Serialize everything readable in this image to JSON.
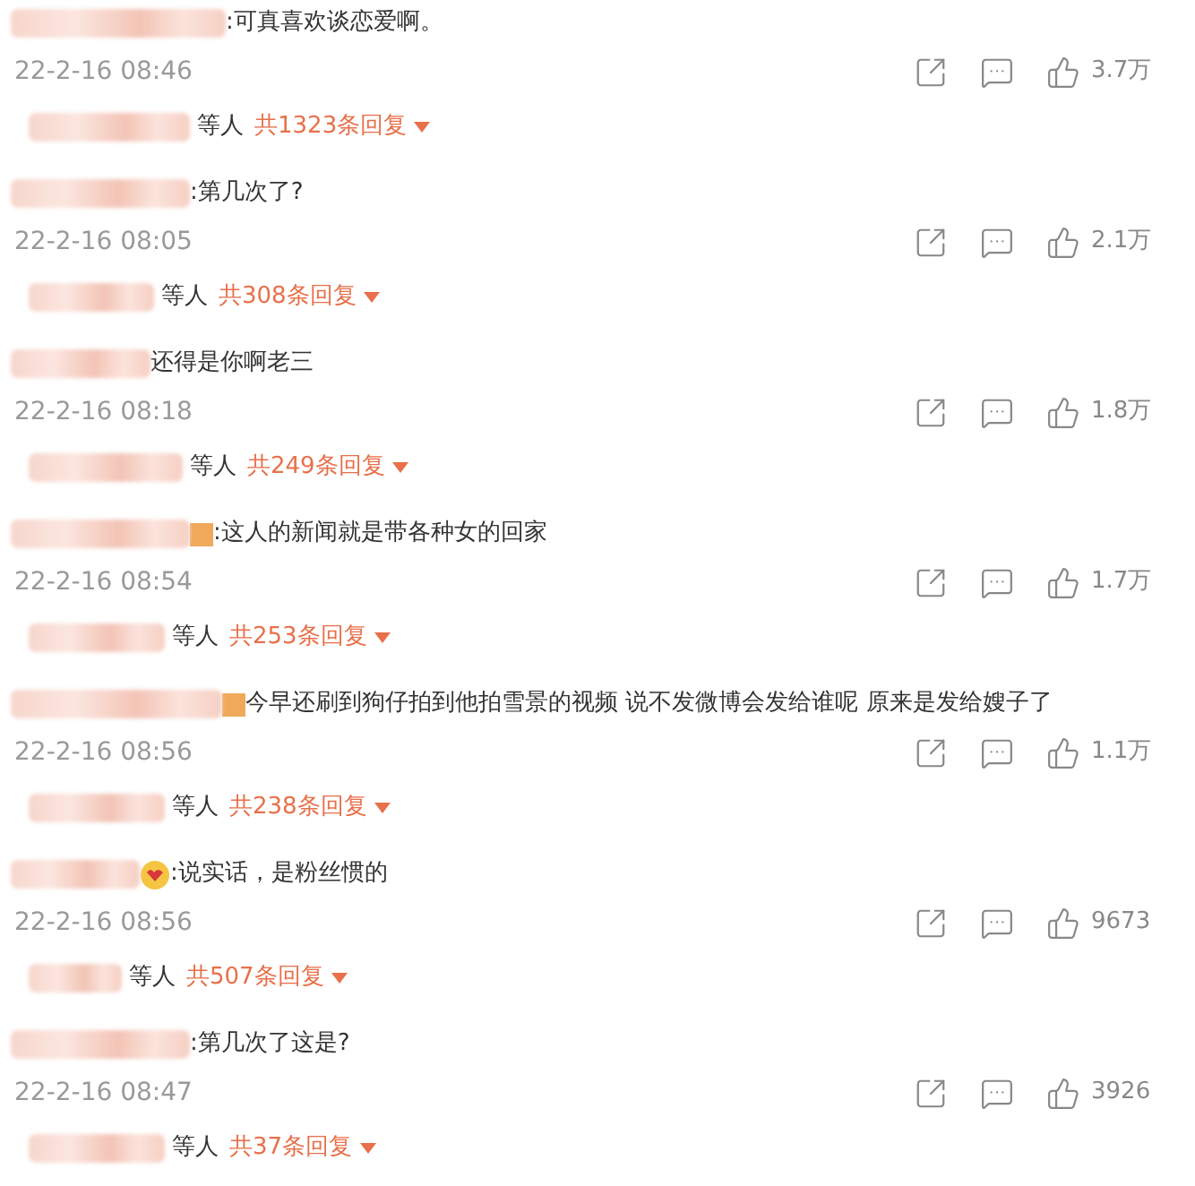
{
  "comments": [
    {
      "kind": "plain",
      "text": ":可真喜欢谈恋爱啊。",
      "time": "22-2-16 08:46",
      "likes": "3.7万",
      "reply_suffix": "等人",
      "reply_count": "共1323条回复"
    },
    {
      "kind": "plain",
      "text": ":第几次了?",
      "time": "22-2-16 08:05",
      "likes": "2.1万",
      "reply_suffix": "等人",
      "reply_count": "共308条回复"
    },
    {
      "kind": "plain",
      "text": "还得是你啊老三",
      "time": "22-2-16 08:18",
      "likes": "1.8万",
      "reply_suffix": "等人",
      "reply_count": "共249条回复"
    },
    {
      "kind": "badge",
      "text": ":这人的新闻就是带各种女的回家",
      "time": "22-2-16 08:54",
      "likes": "1.7万",
      "reply_suffix": "等人",
      "reply_count": "共253条回复"
    },
    {
      "kind": "badge",
      "text": "今早还刷到狗仔拍到他拍雪景的视频 说不发微博会发给谁呢 原来是发给嫂子了",
      "time": "22-2-16 08:56",
      "likes": "1.1万",
      "reply_suffix": "等人",
      "reply_count": "共238条回复"
    },
    {
      "kind": "emoji",
      "text": ":说实话，是粉丝惯的",
      "time": "22-2-16 08:56",
      "likes": "9673",
      "reply_suffix": "等人",
      "reply_count": "共507条回复"
    },
    {
      "kind": "plain",
      "text": ":第几次了这是?",
      "time": "22-2-16 08:47",
      "likes": "3926",
      "reply_suffix": "等人",
      "reply_count": "共37条回复"
    }
  ]
}
